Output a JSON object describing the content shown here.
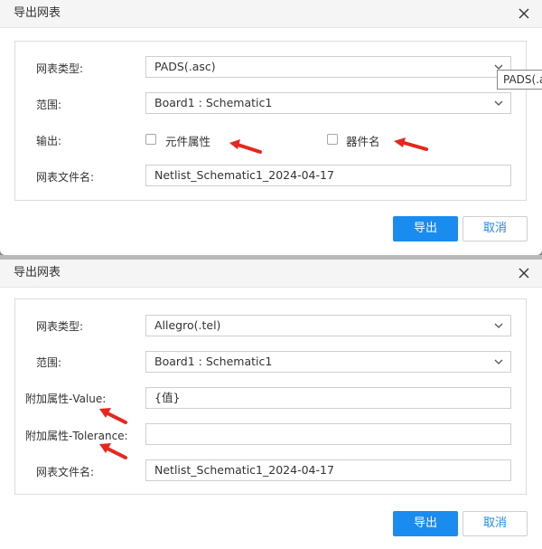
{
  "dialog1": {
    "title": "导出网表",
    "fields": {
      "netlist_type_label": "网表类型:",
      "netlist_type_value": "PADS(.asc)",
      "scope_label": "范围:",
      "scope_value": "Board1 : Schematic1",
      "output_label": "输出:",
      "output_option1": "元件属性",
      "output_option2": "器件名",
      "filename_label": "网表文件名:",
      "filename_value": "Netlist_Schematic1_2024-04-17"
    },
    "tooltip": "PADS(.asc",
    "buttons": {
      "export": "导出",
      "cancel": "取消"
    }
  },
  "dialog2": {
    "title": "导出网表",
    "fields": {
      "netlist_type_label": "网表类型:",
      "netlist_type_value": "Allegro(.tel)",
      "scope_label": "范围:",
      "scope_value": "Board1 : Schematic1",
      "value_label": "附加属性-Value:",
      "value_value": "{值}",
      "tolerance_label": "附加属性-Tolerance:",
      "tolerance_value": "",
      "filename_label": "网表文件名:",
      "filename_value": "Netlist_Schematic1_2024-04-17"
    },
    "buttons": {
      "export": "导出",
      "cancel": "取消"
    }
  },
  "colors": {
    "primary": "#1a8cf0",
    "annotation_arrow": "#e8261e",
    "panel_border": "#dcdcdc"
  },
  "icons": [
    "close-icon",
    "chevron-down-icon",
    "annotation-arrow"
  ]
}
